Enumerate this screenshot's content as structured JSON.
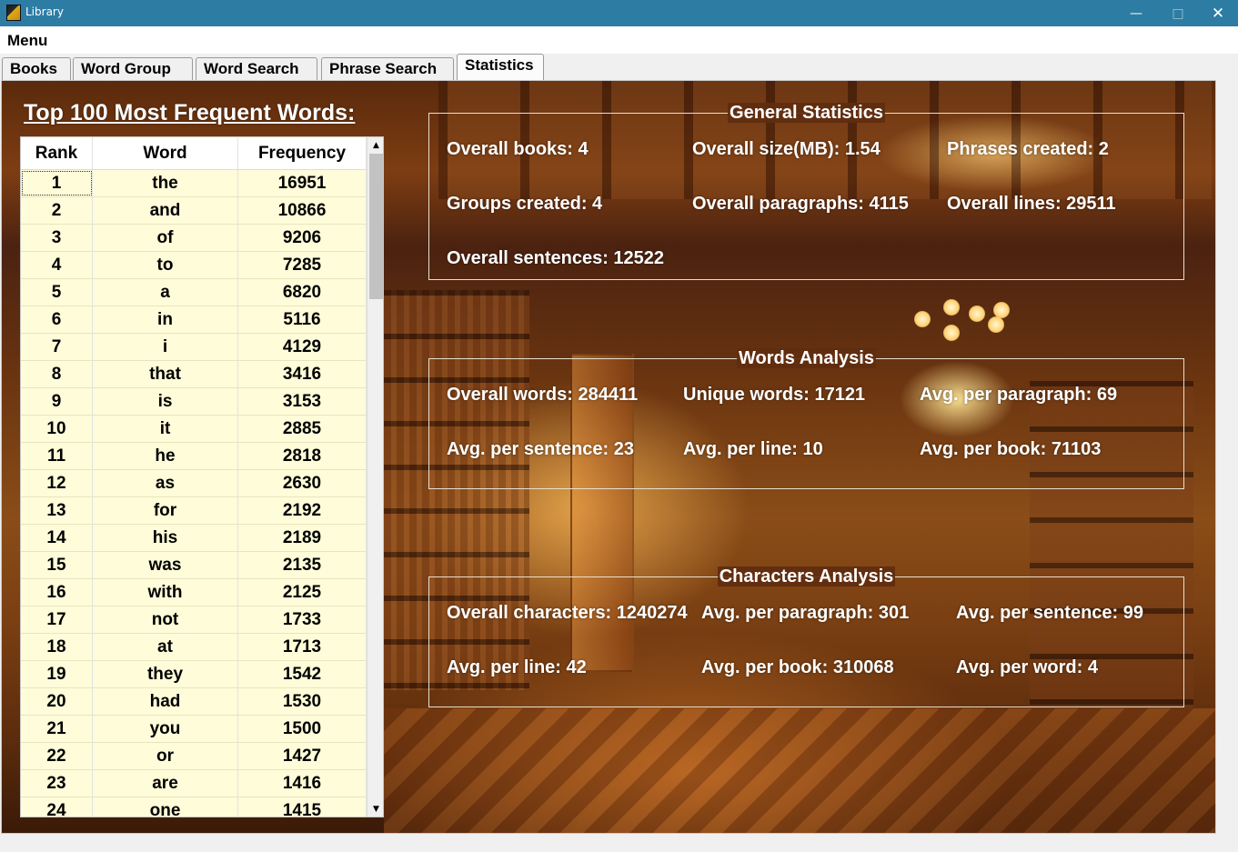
{
  "window": {
    "title": "Library",
    "min_icon": "minimize-icon",
    "max_icon": "maximize-icon",
    "close_icon": "close-icon"
  },
  "menu": {
    "label": "Menu"
  },
  "tabs": [
    {
      "label": "Books"
    },
    {
      "label": "Word Group"
    },
    {
      "label": "Word Search"
    },
    {
      "label": "Phrase Search"
    },
    {
      "label": "Statistics"
    }
  ],
  "frequent": {
    "title": "Top 100 Most Frequent Words:",
    "columns": [
      "Rank",
      "Word",
      "Frequency"
    ],
    "rows": [
      [
        "1",
        "the",
        "16951"
      ],
      [
        "2",
        "and",
        "10866"
      ],
      [
        "3",
        "of",
        "9206"
      ],
      [
        "4",
        "to",
        "7285"
      ],
      [
        "5",
        "a",
        "6820"
      ],
      [
        "6",
        "in",
        "5116"
      ],
      [
        "7",
        "i",
        "4129"
      ],
      [
        "8",
        "that",
        "3416"
      ],
      [
        "9",
        "is",
        "3153"
      ],
      [
        "10",
        "it",
        "2885"
      ],
      [
        "11",
        "he",
        "2818"
      ],
      [
        "12",
        "as",
        "2630"
      ],
      [
        "13",
        "for",
        "2192"
      ],
      [
        "14",
        "his",
        "2189"
      ],
      [
        "15",
        "was",
        "2135"
      ],
      [
        "16",
        "with",
        "2125"
      ],
      [
        "17",
        "not",
        "1733"
      ],
      [
        "18",
        "at",
        "1713"
      ],
      [
        "19",
        "they",
        "1542"
      ],
      [
        "20",
        "had",
        "1530"
      ],
      [
        "21",
        "you",
        "1500"
      ],
      [
        "22",
        "or",
        "1427"
      ],
      [
        "23",
        "are",
        "1416"
      ],
      [
        "24",
        "one",
        "1415"
      ]
    ]
  },
  "general": {
    "title": "General Statistics",
    "books": "Overall books: 4",
    "size": "Overall size(MB): 1.54",
    "phrases": "Phrases created: 2",
    "groups": "Groups created: 4",
    "paragraphs": "Overall paragraphs: 4115",
    "lines": "Overall lines: 29511",
    "sentences": "Overall sentences: 12522"
  },
  "words": {
    "title": "Words Analysis",
    "overall": "Overall words: 284411",
    "unique": "Unique words: 17121",
    "per_paragraph": "Avg. per paragraph: 69",
    "per_sentence": "Avg. per sentence: 23",
    "per_line": "Avg. per line: 10",
    "per_book": "Avg. per book: 71103"
  },
  "characters": {
    "title": "Characters Analysis",
    "overall": "Overall characters: 1240274",
    "per_paragraph": "Avg. per paragraph: 301",
    "per_sentence": "Avg. per sentence: 99",
    "per_line": "Avg. per line: 42",
    "per_book": "Avg. per book: 310068",
    "per_word": "Avg. per word: 4"
  },
  "colors": {
    "titlebar": "#2d7ca3",
    "grid_bg": "#fffcd9",
    "text_light": "#ffffff"
  }
}
